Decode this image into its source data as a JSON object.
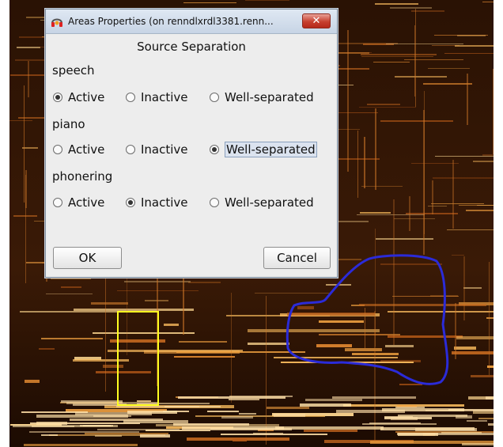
{
  "dialog": {
    "title": "Areas Properties (on renndlxrdl3381.renn...",
    "close_glyph": "✕",
    "heading": "Source Separation",
    "groups": [
      {
        "label": "speech",
        "options": [
          "Active",
          "Inactive",
          "Well-separated"
        ],
        "selected": "Active"
      },
      {
        "label": "piano",
        "options": [
          "Active",
          "Inactive",
          "Well-separated"
        ],
        "selected": "Well-separated"
      },
      {
        "label": "phonering",
        "options": [
          "Active",
          "Inactive",
          "Well-separated"
        ],
        "selected": "Inactive"
      }
    ],
    "ok_label": "OK",
    "cancel_label": "Cancel"
  },
  "colors": {
    "spectrogram_dark": "#1a0a02",
    "spectrogram_bright": "#f0a040",
    "rect_annotation": "#ffff20",
    "freehand_annotation": "#2b2bd8"
  }
}
